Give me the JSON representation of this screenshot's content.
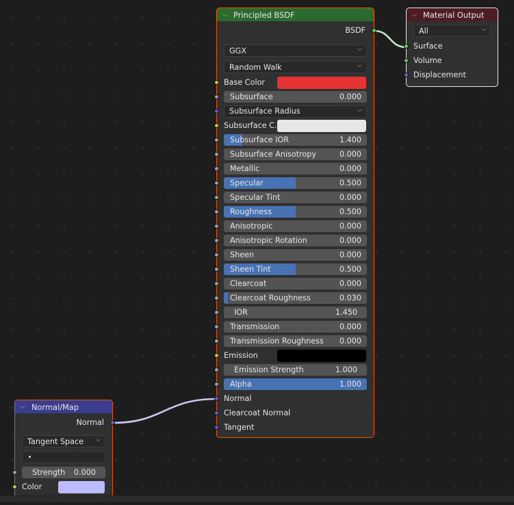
{
  "editor": "Shader Editor",
  "colors": {
    "selected_outline": "#ed5700",
    "active_outline": "#e8e8e8",
    "slider_fill": "#4772b3",
    "slider_bg": "#545454",
    "socket_shader": "#63c763",
    "socket_color": "#c7c729",
    "socket_float": "#a1a1a1",
    "socket_vector": "#6363c7",
    "link_shader": "#c6e6c6",
    "link_vector": "#c9c9f0"
  },
  "nodes": {
    "principled": {
      "title": "Principled BSDF",
      "header_icon": "chevron-down-icon",
      "output_label": "BSDF",
      "distribution": "GGX",
      "subsurface_method": "Random Walk",
      "base_color": {
        "label": "Base Color",
        "value": "#e53232"
      },
      "subsurface": {
        "label": "Subsurface",
        "value": "0.000",
        "fraction": 0.0
      },
      "subsurface_radius": {
        "label": "Subsurface Radius"
      },
      "subsurface_color": {
        "label": "Subsurface C...",
        "value": "#e6e6e6"
      },
      "sliders": [
        {
          "label": "Subsurface IOR",
          "value": "1.400",
          "fraction": 0.13
        },
        {
          "label": "Subsurface Anisotropy",
          "value": "0.000",
          "fraction": 0.0
        },
        {
          "label": "Metallic",
          "value": "0.000",
          "fraction": 0.0
        },
        {
          "label": "Specular",
          "value": "0.500",
          "fraction": 0.5
        },
        {
          "label": "Specular Tint",
          "value": "0.000",
          "fraction": 0.0
        },
        {
          "label": "Roughness",
          "value": "0.500",
          "fraction": 0.5
        },
        {
          "label": "Anisotropic",
          "value": "0.000",
          "fraction": 0.0
        },
        {
          "label": "Anisotropic Rotation",
          "value": "0.000",
          "fraction": 0.0
        },
        {
          "label": "Sheen",
          "value": "0.000",
          "fraction": 0.0
        },
        {
          "label": "Sheen Tint",
          "value": "0.500",
          "fraction": 0.5
        },
        {
          "label": "Clearcoat",
          "value": "0.000",
          "fraction": 0.0
        },
        {
          "label": "Clearcoat Roughness",
          "value": "0.030",
          "fraction": 0.03
        }
      ],
      "ior": {
        "label": "IOR",
        "value": "1.450"
      },
      "sliders2": [
        {
          "label": "Transmission",
          "value": "0.000",
          "fraction": 0.0
        },
        {
          "label": "Transmission Roughness",
          "value": "0.000",
          "fraction": 0.0
        }
      ],
      "emission": {
        "label": "Emission",
        "value": "#000000"
      },
      "emission_strength": {
        "label": "Emission Strength",
        "value": "1.000"
      },
      "alpha": {
        "label": "Alpha",
        "value": "1.000",
        "fraction": 1.0
      },
      "vector_inputs": [
        "Normal",
        "Clearcoat Normal",
        "Tangent"
      ]
    },
    "material_output": {
      "title": "Material Output",
      "header_icon": "chevron-down-icon",
      "target": "All",
      "inputs": [
        "Surface",
        "Volume",
        "Displacement"
      ]
    },
    "normal_map": {
      "title": "Normal/Map",
      "header_icon": "chevron-down-icon",
      "output_label": "Normal",
      "space": "Tangent Space",
      "uv_map": "",
      "strength": {
        "label": "Strength",
        "value": "0.000"
      },
      "color": {
        "label": "Color",
        "value": "#bcbcff"
      }
    }
  },
  "links": [
    {
      "from": "Principled BSDF.BSDF",
      "to": "Material Output.Surface"
    },
    {
      "from": "Normal/Map.Normal",
      "to": "Principled BSDF.Normal"
    }
  ]
}
